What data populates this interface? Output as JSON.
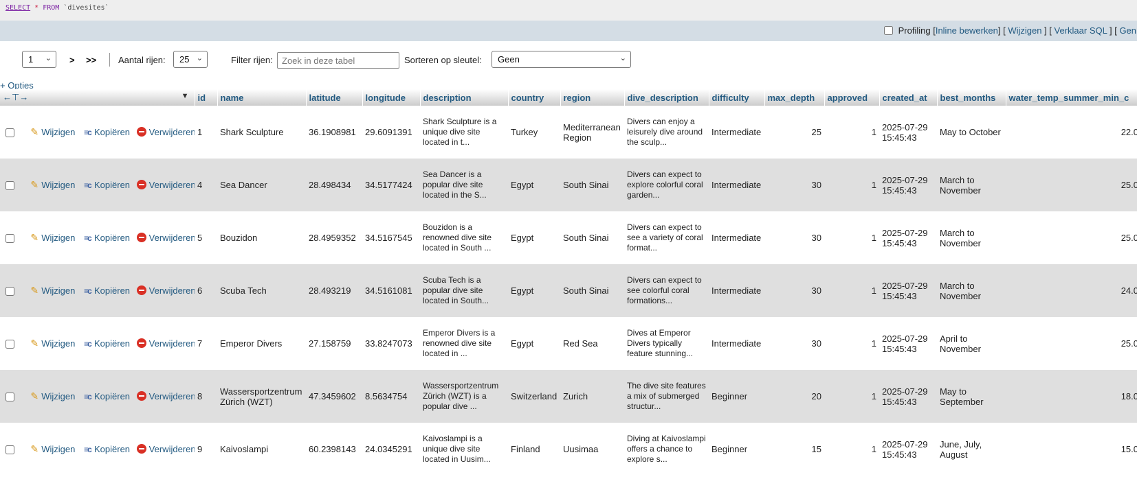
{
  "sql": {
    "select": "SELECT",
    "star": "*",
    "from": "FROM",
    "table": "`divesites`"
  },
  "links": {
    "profiling_label": "Profiling",
    "inline_edit": "Inline bewerken",
    "edit": "Wijzigen",
    "explain": "Verklaar SQL",
    "generate": "Gen"
  },
  "nav": {
    "page": "1",
    "next": ">",
    "last": ">>",
    "rows_label": "Aantal rijen:",
    "rows_value": "25",
    "filter_label": "Filter rijen:",
    "filter_placeholder": "Zoek in deze tabel",
    "sort_label": "Sorteren op sleutel:",
    "sort_value": "Geen"
  },
  "options_label": "+ Opties",
  "actions": {
    "edit": "Wijzigen",
    "copy": "Kopiëren",
    "delete": "Verwijderen"
  },
  "columns": [
    "id",
    "name",
    "latitude",
    "longitude",
    "description",
    "country",
    "region",
    "dive_description",
    "difficulty",
    "max_depth",
    "approved",
    "created_at",
    "best_months",
    "water_temp_summer_min_c"
  ],
  "rows": [
    {
      "id": "1",
      "name": "Shark Sculpture",
      "latitude": "36.1908981",
      "longitude": "29.6091391",
      "description": "Shark Sculpture is a unique dive site located in t...",
      "country": "Turkey",
      "region": "Mediterranean Region",
      "dive_description": "Divers can enjoy a leisurely dive around the sculp...",
      "difficulty": "Intermediate",
      "max_depth": "25",
      "approved": "1",
      "created_at": "2025-07-29 15:45:43",
      "best_months": "May to October",
      "water_temp": "22.0"
    },
    {
      "id": "4",
      "name": "Sea Dancer",
      "latitude": "28.498434",
      "longitude": "34.5177424",
      "description": "Sea Dancer is a popular dive site located in the S...",
      "country": "Egypt",
      "region": "South Sinai",
      "dive_description": "Divers can expect to explore colorful coral garden...",
      "difficulty": "Intermediate",
      "max_depth": "30",
      "approved": "1",
      "created_at": "2025-07-29 15:45:43",
      "best_months": "March to November",
      "water_temp": "25.0"
    },
    {
      "id": "5",
      "name": "Bouzidon",
      "latitude": "28.4959352",
      "longitude": "34.5167545",
      "description": "Bouzidon is a renowned dive site located in South ...",
      "country": "Egypt",
      "region": "South Sinai",
      "dive_description": "Divers can expect to see a variety of coral format...",
      "difficulty": "Intermediate",
      "max_depth": "30",
      "approved": "1",
      "created_at": "2025-07-29 15:45:43",
      "best_months": "March to November",
      "water_temp": "25.0"
    },
    {
      "id": "6",
      "name": "Scuba Tech",
      "latitude": "28.493219",
      "longitude": "34.5161081",
      "description": "Scuba Tech is a popular dive site located in South...",
      "country": "Egypt",
      "region": "South Sinai",
      "dive_description": "Divers can expect to see colorful coral formations...",
      "difficulty": "Intermediate",
      "max_depth": "30",
      "approved": "1",
      "created_at": "2025-07-29 15:45:43",
      "best_months": "March to November",
      "water_temp": "24.0"
    },
    {
      "id": "7",
      "name": "Emperor Divers",
      "latitude": "27.158759",
      "longitude": "33.8247073",
      "description": "Emperor Divers is a renowned dive site located in ...",
      "country": "Egypt",
      "region": "Red Sea",
      "dive_description": "Dives at Emperor Divers typically feature stunning...",
      "difficulty": "Intermediate",
      "max_depth": "30",
      "approved": "1",
      "created_at": "2025-07-29 15:45:43",
      "best_months": "April to November",
      "water_temp": "25.0"
    },
    {
      "id": "8",
      "name": "Wassersportzentrum Zürich (WZT)",
      "latitude": "47.3459602",
      "longitude": "8.5634754",
      "description": "Wassersportzentrum Zürich (WZT) is a popular dive ...",
      "country": "Switzerland",
      "region": "Zurich",
      "dive_description": "The dive site features a mix of submerged structur...",
      "difficulty": "Beginner",
      "max_depth": "20",
      "approved": "1",
      "created_at": "2025-07-29 15:45:43",
      "best_months": "May to September",
      "water_temp": "18.0"
    },
    {
      "id": "9",
      "name": "Kaivoslampi",
      "latitude": "60.2398143",
      "longitude": "24.0345291",
      "description": "Kaivoslampi is a unique dive site located in Uusim...",
      "country": "Finland",
      "region": "Uusimaa",
      "dive_description": "Diving at Kaivoslampi offers a chance to explore s...",
      "difficulty": "Beginner",
      "max_depth": "15",
      "approved": "1",
      "created_at": "2025-07-29 15:45:43",
      "best_months": "June, July, August",
      "water_temp": "15.0"
    }
  ]
}
